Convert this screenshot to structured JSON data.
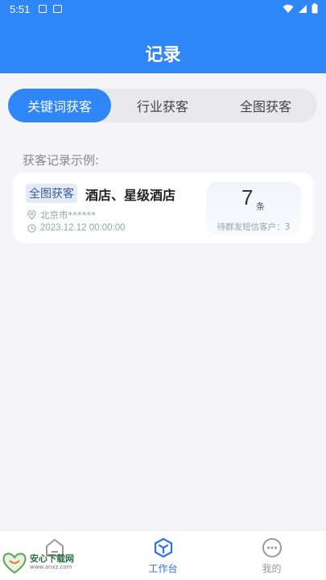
{
  "status_bar": {
    "time": "5:51"
  },
  "header": {
    "title": "记录"
  },
  "tabs": [
    {
      "label": "关键词获客",
      "active": true
    },
    {
      "label": "行业获客",
      "active": false
    },
    {
      "label": "全图获客",
      "active": false
    }
  ],
  "section_label": "获客记录示例:",
  "record": {
    "badge": "全图获客",
    "title": "酒店、星级酒店",
    "location": "北京市******",
    "datetime": "2023.12.12 00:00:00",
    "count": "7",
    "count_unit": "条",
    "note": "待群发短信客户：3"
  },
  "nav": [
    {
      "label": "",
      "icon": "home-icon"
    },
    {
      "label": "工作台",
      "icon": "workbench-cube-icon",
      "active": true
    },
    {
      "label": "我的",
      "icon": "profile-dots-icon"
    }
  ],
  "watermark": {
    "brand": "安心下载网",
    "url": "www.anxz.com"
  },
  "colors": {
    "primary": "#2f86f6",
    "nav_active": "#2f6ff0",
    "background": "#f5f5f7"
  }
}
